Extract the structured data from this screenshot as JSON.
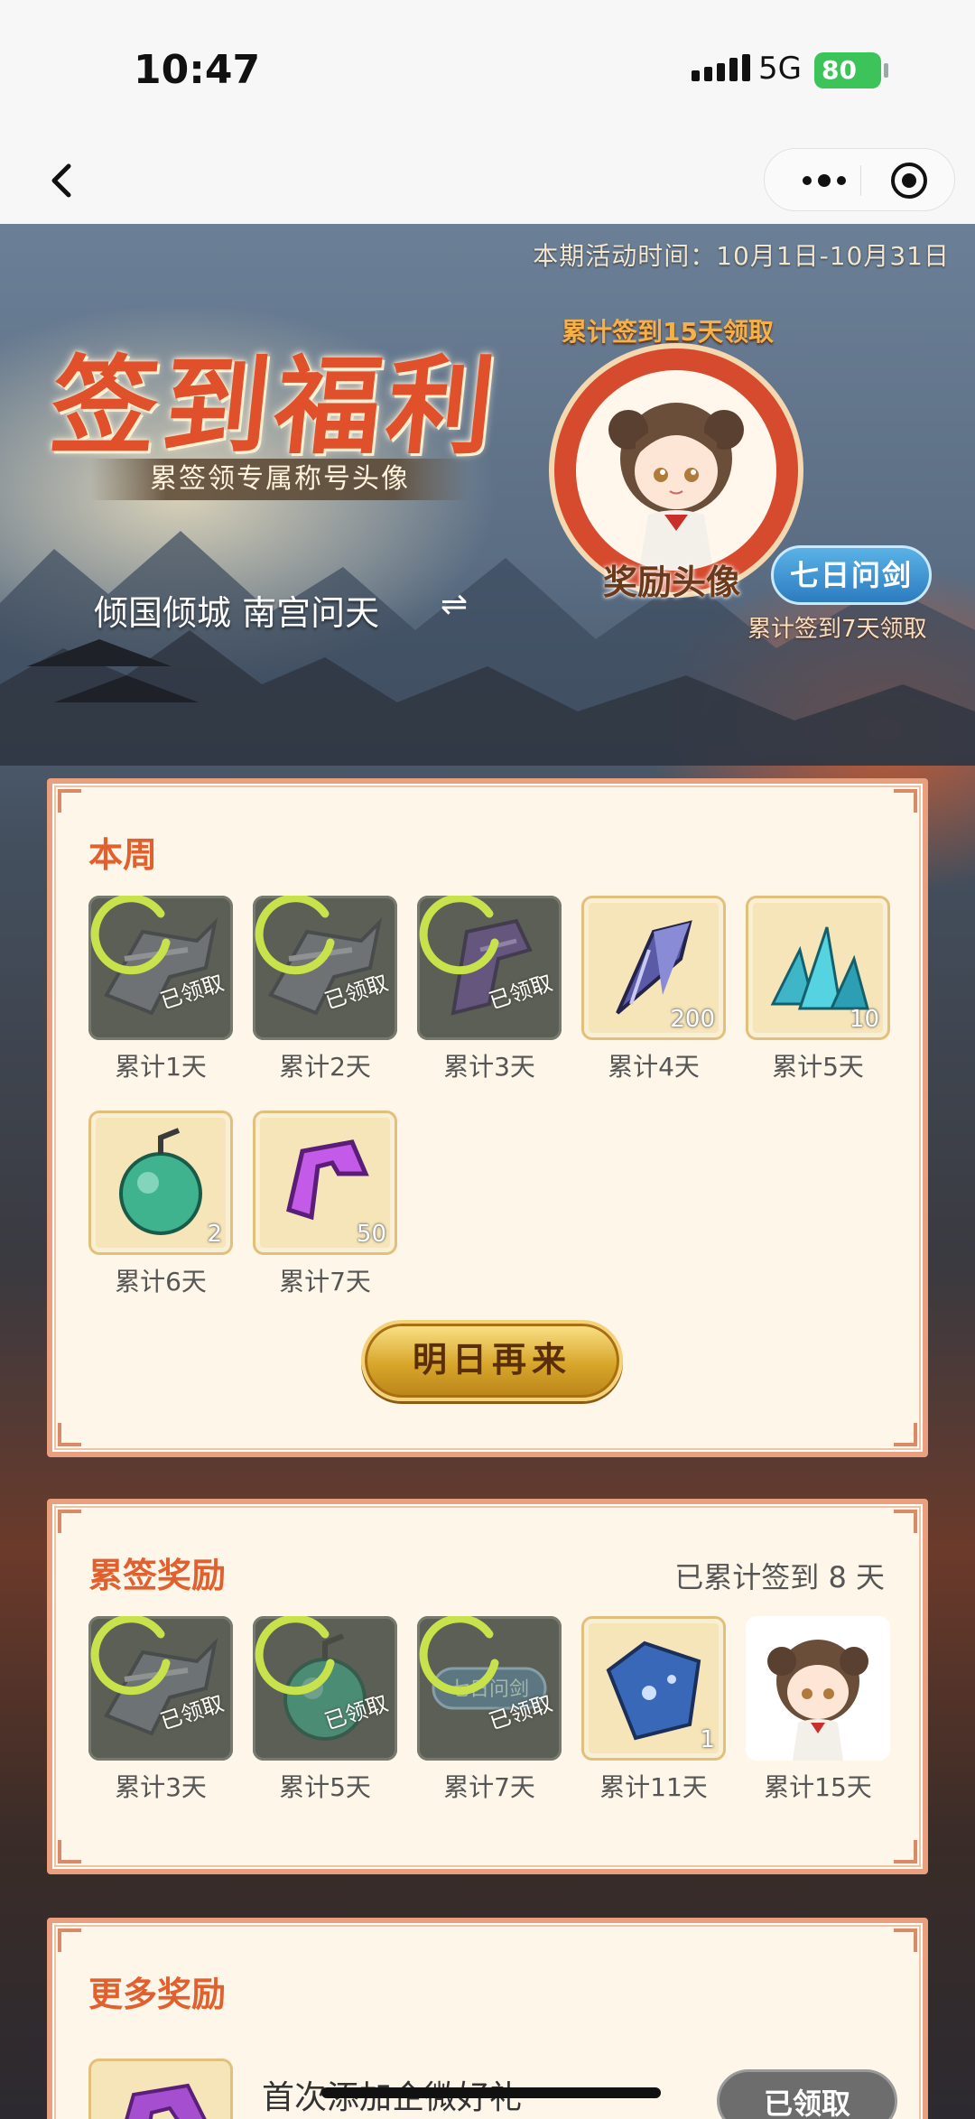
{
  "status_bar": {
    "time": "10:47",
    "network": "5G",
    "battery": "80"
  },
  "nav": {
    "back_icon": "chevron-left-icon",
    "more_icon": "more-dots-icon",
    "close_icon": "target-icon"
  },
  "hero": {
    "period": "本期活动时间：10月1日-10月31日",
    "title": "签到福利",
    "subtitle": "累签领专属称号头像",
    "user_title": "倾国倾城 南宫问天",
    "avatar_caption": "累计签到15天领取",
    "avatar_label": "奖励头像",
    "title_badge": "七日问剑",
    "title_badge_caption": "累计签到7天领取",
    "swap_icon": "swap-icon"
  },
  "weekly": {
    "title": "本周",
    "items": [
      {
        "label": "累计1天",
        "state": "claimed",
        "icon": "weapon-icon",
        "status_text": "已领取",
        "qty": ""
      },
      {
        "label": "累计2天",
        "state": "claimed",
        "icon": "weapon-icon",
        "status_text": "已领取",
        "qty": ""
      },
      {
        "label": "累计3天",
        "state": "claimed",
        "icon": "purple-crystal-icon",
        "status_text": "已领取",
        "qty": ""
      },
      {
        "label": "累计4天",
        "state": "available",
        "icon": "dark-crystal-icon",
        "status_text": "",
        "qty": "200"
      },
      {
        "label": "累计5天",
        "state": "available",
        "icon": "blue-crystal-icon",
        "status_text": "",
        "qty": "10"
      },
      {
        "label": "累计6天",
        "state": "available",
        "icon": "green-gourd-icon",
        "status_text": "",
        "qty": "2"
      },
      {
        "label": "累计7天",
        "state": "available",
        "icon": "purple-gem-icon",
        "status_text": "",
        "qty": "50"
      }
    ],
    "cta_label": "明日再来"
  },
  "cumulative": {
    "title": "累签奖励",
    "count_text": "已累计签到 8 天",
    "items": [
      {
        "label": "累计3天",
        "state": "claimed",
        "icon": "weapon-icon",
        "status_text": "已领取",
        "qty": ""
      },
      {
        "label": "累计5天",
        "state": "claimed",
        "icon": "green-gourd-icon",
        "status_text": "已领取",
        "qty": ""
      },
      {
        "label": "累计7天",
        "state": "claimed",
        "icon": "title-badge-icon",
        "status_text": "已领取",
        "qty": ""
      },
      {
        "label": "累计11天",
        "state": "available",
        "icon": "blue-scroll-icon",
        "status_text": "",
        "qty": "1"
      },
      {
        "label": "累计15天",
        "state": "avatar",
        "icon": "avatar-icon",
        "status_text": "",
        "qty": ""
      }
    ]
  },
  "more": {
    "title": "更多奖励",
    "row_text": "首次添加企微好礼",
    "row_button": "已领取"
  }
}
